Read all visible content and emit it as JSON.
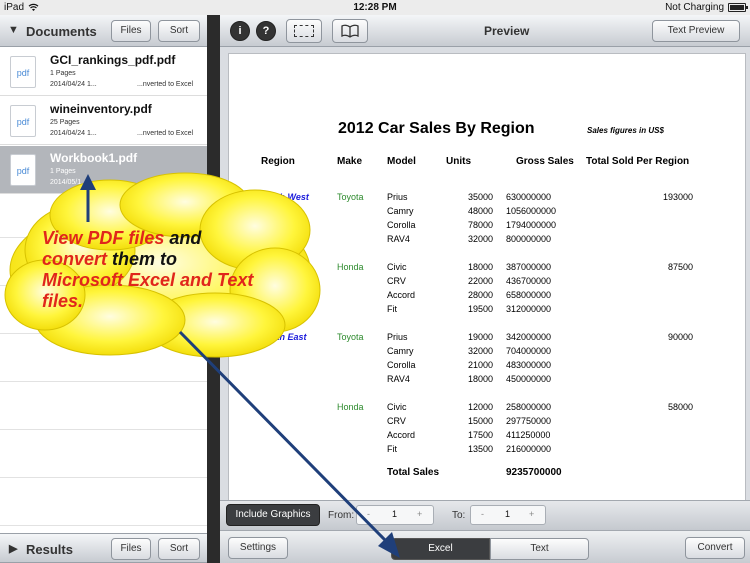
{
  "status": {
    "device": "iPad",
    "time": "12:28 PM",
    "charging": "Not Charging"
  },
  "left_header": {
    "title": "Documents",
    "files_btn": "Files",
    "sort_btn": "Sort"
  },
  "documents": [
    {
      "name": "GCI_rankings_pdf.pdf",
      "pages": "1 Pages",
      "date": "2014/04/24 1...",
      "status": "...nverted to Excel",
      "icon": "pdf"
    },
    {
      "name": "wineinventory.pdf",
      "pages": "25 Pages",
      "date": "2014/04/24 1...",
      "status": "...nverted to Excel",
      "icon": "pdf"
    },
    {
      "name": "Workbook1.pdf",
      "pages": "1 Pages",
      "date": "2014/05/1...",
      "status": "...nverted to Excel",
      "icon": "pdf"
    }
  ],
  "left_footer": {
    "title": "Results",
    "files_btn": "Files",
    "sort_btn": "Sort"
  },
  "preview_header": {
    "title": "Preview",
    "text_preview_btn": "Text Preview"
  },
  "document": {
    "title": "2012 Car Sales By Region",
    "subtitle": "Sales figures in US$",
    "headers": [
      "Region",
      "Make",
      "Model",
      "Units",
      "Gross Sales",
      "Total Sold Per Region"
    ],
    "groups": [
      {
        "region": "North West",
        "make": "Toyota",
        "total": "193000",
        "rows": [
          [
            "Prius",
            "35000",
            "630000000"
          ],
          [
            "Camry",
            "48000",
            "1056000000"
          ],
          [
            "Corolla",
            "78000",
            "1794000000"
          ],
          [
            "RAV4",
            "32000",
            "800000000"
          ]
        ]
      },
      {
        "region": "",
        "make": "Honda",
        "total": "87500",
        "rows": [
          [
            "Civic",
            "18000",
            "387000000"
          ],
          [
            "CRV",
            "22000",
            "436700000"
          ],
          [
            "Accord",
            "28000",
            "658000000"
          ],
          [
            "Fit",
            "19500",
            "312000000"
          ]
        ]
      },
      {
        "region": "North East",
        "make": "Toyota",
        "total": "90000",
        "rows": [
          [
            "Prius",
            "19000",
            "342000000"
          ],
          [
            "Camry",
            "32000",
            "704000000"
          ],
          [
            "Corolla",
            "21000",
            "483000000"
          ],
          [
            "RAV4",
            "18000",
            "450000000"
          ]
        ]
      },
      {
        "region": "",
        "make": "Honda",
        "total": "58000",
        "rows": [
          [
            "Civic",
            "12000",
            "258000000"
          ],
          [
            "CRV",
            "15000",
            "297750000"
          ],
          [
            "Accord",
            "17500",
            "411250000"
          ],
          [
            "Fit",
            "13500",
            "216000000"
          ]
        ]
      }
    ],
    "total_label": "Total Sales",
    "total_value": "9235700000"
  },
  "range_bar": {
    "include_graphics": "Include Graphics",
    "from_label": "From:",
    "from_value": "1",
    "to_label": "To:",
    "to_value": "1",
    "minus": "-",
    "plus": "+"
  },
  "action_bar": {
    "settings": "Settings",
    "excel": "Excel",
    "text": "Text",
    "convert": "Convert"
  },
  "callout": {
    "line1a": "View PDF files",
    "line1b": " and",
    "line2a": "convert",
    "line2b": " them to",
    "line3": "Microsoft Excel and Text",
    "line4": "files."
  },
  "colors": {
    "accent_red": "#e0261b",
    "region_blue": "#1a1adb",
    "make_green": "#2d8a2d",
    "callout_yellow": "#fff53b"
  }
}
